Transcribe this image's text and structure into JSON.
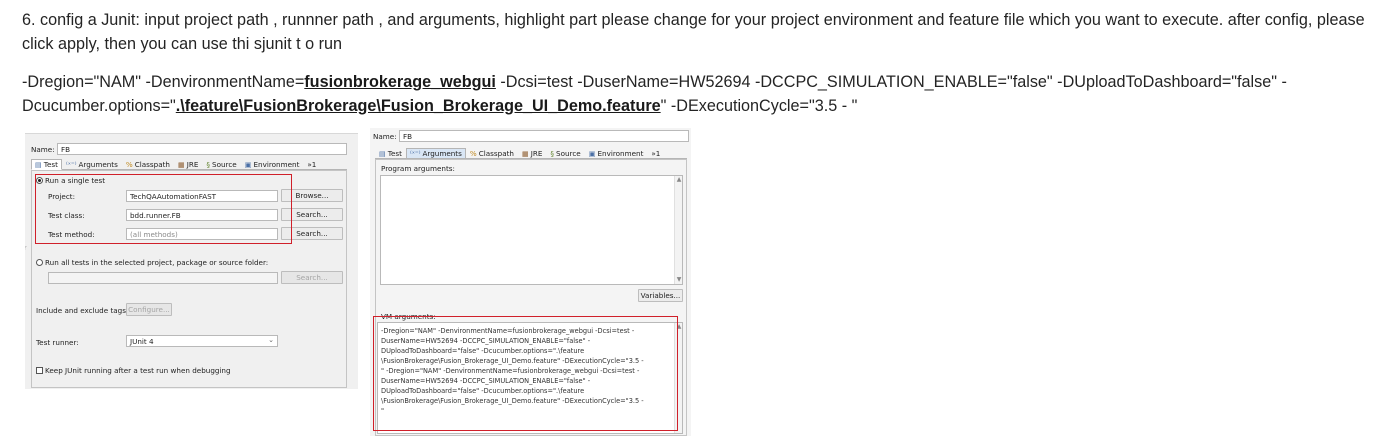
{
  "instructions": {
    "p1": "6. config a Junit: input project path , runnner path , and arguments, highlight part please change for your project environment and feature file which you want to execute. after config, please click apply, then you can use thi sjunit t o run",
    "p2_a": "-Dregion=\"NAM\" -DenvironmentName=",
    "p2_env": "fusionbrokerage_webgui",
    "p2_b": " -Dcsi=test -DuserName=HW52694 -DCCPC_SIMULATION_ENABLE=\"false\" -DUploadToDashboard=\"false\" -Dcucumber.options=\"",
    "p2_feature": ".\\feature\\FusionBrokerage\\Fusion_Brokerage_UI_Demo.feature",
    "p2_c": "\" -DExecutionCycle=\"3.5 - \""
  },
  "dialog1": {
    "name_label": "Name:",
    "name_value": "FB",
    "tabs": [
      "Test",
      "Arguments",
      "Classpath",
      "JRE",
      "Source",
      "Environment",
      "»1"
    ],
    "single_test_label": "Run a single test",
    "project_label": "Project:",
    "project_value": "TechQAAutomationFAST",
    "browse_button": "Browse...",
    "test_class_label": "Test class:",
    "test_class_value": "bdd.runner.FB",
    "search_button": "Search...",
    "test_method_label": "Test method:",
    "test_method_placeholder": "(all methods)",
    "search_button_2": "Search...",
    "run_all_label": "Run all tests in the selected project, package or source folder:",
    "search_button_3": "Search...",
    "tags_label": "Include and exclude tags:",
    "configure_button": "Configure...",
    "runner_label": "Test runner:",
    "runner_value": "JUnit 4",
    "keep_label": "Keep JUnit running after a test run when debugging"
  },
  "dialog2": {
    "name_label": "Name:",
    "name_value": "FB",
    "tabs": [
      "Test",
      "Arguments",
      "Classpath",
      "JRE",
      "Source",
      "Environment",
      "»1"
    ],
    "program_args_label": "Program arguments:",
    "variables_button": "Variables...",
    "vm_args_label": "VM arguments:",
    "vm_args_text": "-Dregion=\"NAM\" -DenvironmentName=fusionbrokerage_webgui -Dcsi=test -\nDuserName=HW52694 -DCCPC_SIMULATION_ENABLE=\"false\" -\nDUploadToDashboard=\"false\" -Dcucumber.options=\".\\feature\n\\FusionBrokerage\\Fusion_Brokerage_UI_Demo.feature\" -DExecutionCycle=\"3.5 -\n\" -Dregion=\"NAM\" -DenvironmentName=fusionbrokerage_webgui -Dcsi=test -\nDuserName=HW52694 -DCCPC_SIMULATION_ENABLE=\"false\" -\nDUploadToDashboard=\"false\" -Dcucumber.options=\".\\feature\n\\FusionBrokerage\\Fusion_Brokerage_UI_Demo.feature\" -DExecutionCycle=\"3.5 -\n\""
  },
  "colors": {
    "highlight_box": "#d0202a",
    "tab_selected": "#d9e6f5"
  }
}
